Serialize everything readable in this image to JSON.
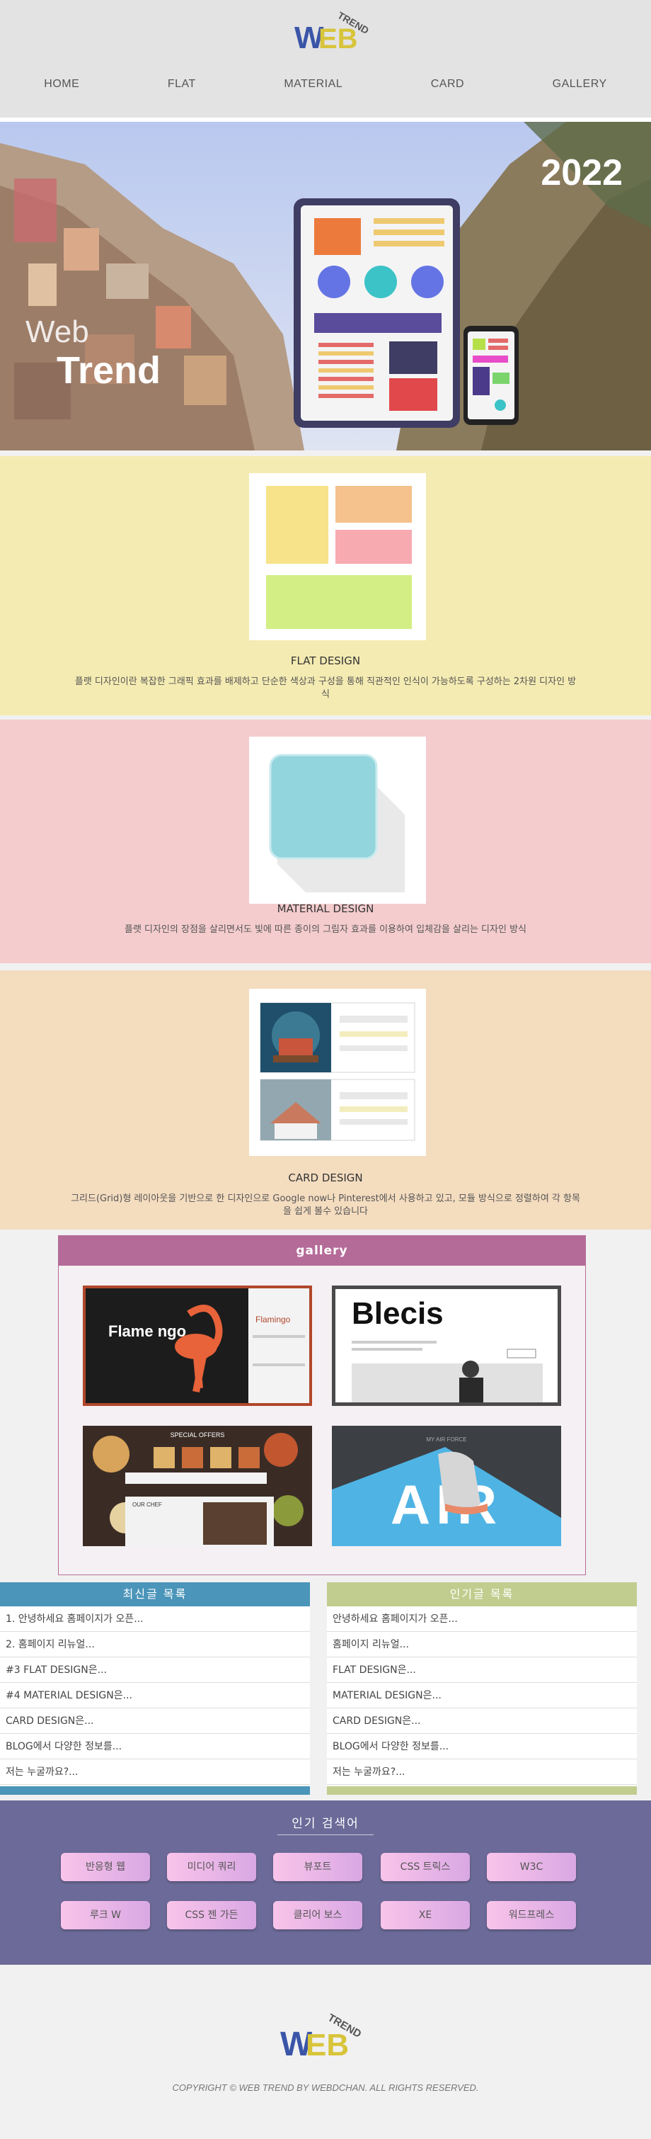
{
  "header": {
    "logo": {
      "word": "WEB",
      "sub": "TREND"
    },
    "nav": [
      "HOME",
      "FLAT",
      "MATERIAL",
      "CARD",
      "GALLERY"
    ]
  },
  "hero": {
    "year": "2022",
    "line1": "Web",
    "line2": "Trend"
  },
  "sections": [
    {
      "title": "FLAT DESIGN",
      "desc": "플랫 디자인이란 복잡한 그래픽 효과를 배제하고 단순한 색상과 구성을 통해 직관적인 인식이 가능하도록 구성하는 2차원 디자인 방식"
    },
    {
      "title": "MATERIAL DESIGN",
      "desc": "플랫 디자인의 장점을 살리면서도 빛에 따른 종이의 그림자 효과를 이용하여 입체감을 살리는 디자인 방식"
    },
    {
      "title": "CARD DESIGN",
      "desc": "그리드(Grid)형 레이아웃을 기반으로 한 디자인으로 Google now나 Pinterest에서 사용하고 있고, 모듈 방식으로 정렬하여 각 항목을 쉽게 볼수 있습니다"
    }
  ],
  "gallery": {
    "title": "gallery",
    "images": [
      {
        "name": "flamingo",
        "text1": "Flame ngo",
        "text2": "Flamingo"
      },
      {
        "name": "blecis",
        "text1": "Blecis"
      },
      {
        "name": "food",
        "text1": "SPECIAL OFFERS",
        "text2": "OUR CHEF"
      },
      {
        "name": "air",
        "text1": "AIR",
        "text2": "MY AIR FORCE"
      }
    ]
  },
  "lists": {
    "latest": {
      "title": "최신글 목록",
      "items": [
        "1. 안녕하세요 홈페이지가 오픈...",
        "2. 홈페이지 리뉴얼...",
        "#3 FLAT DESIGN은...",
        "#4 MATERIAL DESIGN은...",
        "CARD DESIGN은...",
        "BLOG에서 다양한 정보를...",
        "저는 누굴까요?..."
      ],
      "color": "#4a95b9"
    },
    "popular": {
      "title": "인기글 목록",
      "items": [
        "안녕하세요 홈페이지가 오픈...",
        "홈페이지 리뉴얼...",
        "FLAT DESIGN은...",
        "MATERIAL DESIGN은...",
        "CARD DESIGN은...",
        "BLOG에서 다양한 정보를...",
        "저는 누굴까요?..."
      ],
      "color": "#c1cd8e"
    }
  },
  "tags": {
    "title": "인기 검색어",
    "items": [
      "반응형 웹",
      "미디어 쿼리",
      "뷰포트",
      "CSS 트릭스",
      "W3C",
      "루크 W",
      "CSS 젠 가든",
      "클리어 보스",
      "XE",
      "워드프레스"
    ]
  },
  "footer": {
    "copyright": "COPYRIGHT © WEB TREND BY WEBDCHAN. ALL RIGHTS RESERVED."
  }
}
